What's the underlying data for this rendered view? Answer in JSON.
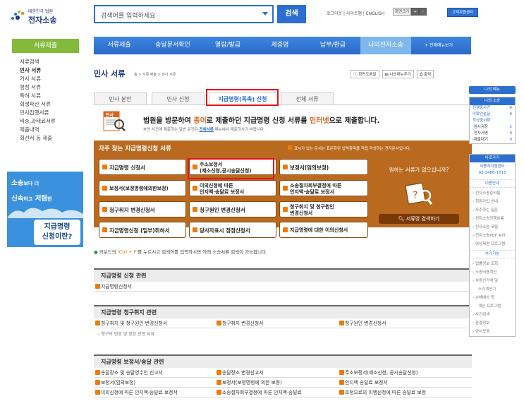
{
  "header": {
    "logo_line1": "대한민국 법원",
    "logo_line2": "전자소송",
    "search_placeholder": "검색어를 입력하세요",
    "search_button": "검색",
    "toplinks": "로그아웃 | 사이트맵 | ENGLISH",
    "font_size_label": "화면크기",
    "font_plus": "+",
    "font_minus": "-",
    "customer_center": "고객지원센터"
  },
  "nav": {
    "items": [
      "서류제출",
      "송달문서확인",
      "열람/발급",
      "제증명",
      "납부/환급",
      "나의전자소송"
    ],
    "all_menu": "+ 전체메뉴보기"
  },
  "left": {
    "header": "서류제출",
    "items": [
      "서류검색",
      "민사 서류",
      "가사 서류",
      "행정 서류",
      "특허 서류",
      "회생파산 서류",
      "민사집행서류",
      "비송,과태료서류",
      "제출내역",
      "회선서 등 제출"
    ],
    "banner_line1a": "소송",
    "banner_line1b": "보다 더",
    "banner_line2a": "신속",
    "banner_line2b": "하고",
    "banner_line2c": "저렴",
    "banner_line2d": "한",
    "banner_box1": "지급명령",
    "banner_box2": "신청이란?"
  },
  "page": {
    "title": "민사 서류",
    "breadcrumb": "홈 > 서류 제출 > 민사 서류",
    "btn_help": "화면도움말",
    "btn_mymenu": "나의메뉴추가",
    "btn_print": "출력"
  },
  "tabs": [
    "민사 본안",
    "민사 신청",
    "지급명령(독촉) 신청",
    "전체 서류"
  ],
  "intro": {
    "icon_label": "민사",
    "t1_a": "법원을 방문하여 ",
    "t1_b": "종이",
    "t1_c": "로 제출하던 지급명령 신청 서류를 ",
    "t1_d": "인터넷",
    "t1_e": "으로 제출합니다.",
    "t2_a": "본안 사건에 제출하는 일반 문건은 ",
    "t2_link": "전체서류",
    "t2_b": " 메뉴에서 제출하시기 바랍니다."
  },
  "favorites": {
    "title": "자주 찾는 지급명령신청 서류",
    "note": "표시가 있는 문서는 표준화된 입력항목을 직접 작성하는 전자문서입니다.",
    "buttons": [
      [
        "지급명령 신청서",
        "주소보정서\n(제소신청,공시송달신청)",
        "보정서(임의보정)"
      ],
      [
        "보정서(보정명령에의한보정)",
        "이의신청에 따른\n인지액·송달료 보정서",
        "소송절차회부결정에 따른\n인지액·송달료 보정서"
      ],
      [
        "청구취지 변경신청서",
        "청구원인 변경신청서",
        "청구취지 및 청구원인\n변경신청서"
      ],
      [
        "지급명령신청 (일부)취하서",
        "당사자표시 정정신청서",
        "지급명령에 대한 이의신청서"
      ]
    ],
    "right_question": "원하는 서류가 없으십니까?",
    "right_button": "서류명 검색하기"
  },
  "keyboard": {
    "a": "키보드의 '",
    "k": "Ctrl + F",
    "b": "'를 누르시고 검색어를 입력하시면 아래 소송서류 검색이 가능합니다."
  },
  "sections": [
    {
      "title": "지급명령 신청 관련",
      "rows": [
        [
          "지급명령신청서"
        ]
      ]
    },
    {
      "title": "지급명령 청구취지 관련",
      "rows": [
        [
          "청구취지 및 청구원인 변경신청서",
          "청구취지 변경신청서",
          "청구원인 변경신청서"
        ]
      ],
      "sub": "청구의 변경 및 정정 관련 서류"
    },
    {
      "title": "지급명령 보정서/송달 관련",
      "rows": [
        [
          "송달장소 및 송달영수인 신고서",
          "송달장소 변경신고서",
          "주소보정서(제소신청, 공시송달신청)"
        ],
        [
          "보정서(임의보정)",
          "보정서(보정명령에 의한 보정)",
          "인지액 송달료 보정서"
        ],
        [
          "이의신청에 따른 인지액·송달료 보정서",
          "소송절차회부결정에 따른 인지액·송달료",
          "조정으로의 이행신청에 따른 송달료 보정"
        ]
      ]
    }
  ],
  "right": {
    "my_menu": "나의 메뉴",
    "my_case_hd": "나의 소송",
    "case_rows": [
      [
        "진행중사건",
        "4"
      ],
      [
        "미확인송달",
        "0"
      ],
      [
        "작성중서류",
        ""
      ],
      [
        "·임시저장",
        "1"
      ],
      [
        "·전자서명",
        "0"
      ],
      [
        "·제출대기",
        "0"
      ]
    ],
    "goto_hd": "바로가기",
    "court_line1": "사용자지원센터",
    "court_line2": "02-3480-1715",
    "guide_hd": "이용안내",
    "links": [
      "전자소송준비물",
      "회원가입 안내",
      "자주하는 질문",
      "전자소송진행흐름",
      "전자소송 포털",
      "전자소송PDF 뷰어",
      "명상재판 프로그램"
    ],
    "extra_hd": "부가기능",
    "extra": [
      "법률정보 조회",
      "소송비용계산",
      "부동산가액 및",
      "소가계산기",
      "손해배상 등",
      "계산 프로그램",
      "사건검색",
      "판결정보",
      "양식모음"
    ]
  },
  "colors": {
    "brand_blue": "#2c6fd1",
    "fav_brown": "#b96a1f",
    "left_green": "#85b93b",
    "highlight_red": "#e3141b",
    "accent_orange": "#f07a0a"
  }
}
